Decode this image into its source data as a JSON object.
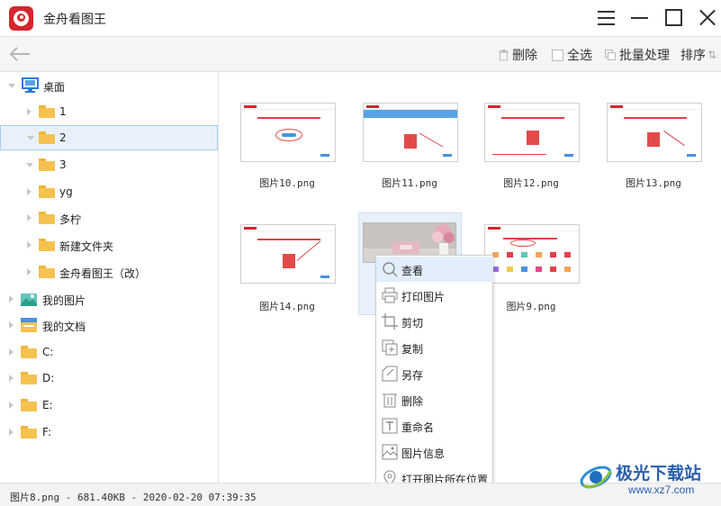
{
  "app": {
    "title": "金舟看图王"
  },
  "toolbar": {
    "delete_label": "删除",
    "select_all_label": "全选",
    "batch_label": "批量处理",
    "sort_label": "排序"
  },
  "sidebar": {
    "items": [
      {
        "label": "桌面",
        "icon": "desktop-icon"
      },
      {
        "label": "1",
        "icon": "folder-icon"
      },
      {
        "label": "2",
        "icon": "folder-icon"
      },
      {
        "label": "3",
        "icon": "folder-icon"
      },
      {
        "label": "yg",
        "icon": "folder-icon"
      },
      {
        "label": "多柠",
        "icon": "folder-icon"
      },
      {
        "label": "新建文件夹",
        "icon": "folder-icon"
      },
      {
        "label": "金舟看图王（改）",
        "icon": "folder-icon"
      },
      {
        "label": "我的图片",
        "icon": "pictures-icon"
      },
      {
        "label": "我的文档",
        "icon": "documents-icon"
      },
      {
        "label": "C:",
        "icon": "folder-icon"
      },
      {
        "label": "D:",
        "icon": "folder-icon"
      },
      {
        "label": "E:",
        "icon": "folder-icon"
      },
      {
        "label": "F:",
        "icon": "folder-icon"
      }
    ],
    "selected": "2"
  },
  "thumbnails": [
    {
      "name": "图片10.png"
    },
    {
      "name": "图片11.png"
    },
    {
      "name": "图片12.png"
    },
    {
      "name": "图片13.png"
    },
    {
      "name": "图片14.png"
    },
    {
      "name": "图片8.png"
    },
    {
      "name": "图片9.png"
    }
  ],
  "context_menu": {
    "items": [
      {
        "label": "查看",
        "icon": "magnifier-icon"
      },
      {
        "label": "打印图片",
        "icon": "printer-icon"
      },
      {
        "label": "剪切",
        "icon": "crop-icon"
      },
      {
        "label": "复制",
        "icon": "copy-icon"
      },
      {
        "label": "另存",
        "icon": "save-as-icon"
      },
      {
        "label": "删除",
        "icon": "trash-icon"
      },
      {
        "label": "重命名",
        "icon": "rename-icon"
      },
      {
        "label": "图片信息",
        "icon": "image-info-icon"
      },
      {
        "label": "打开图片所在位置",
        "icon": "location-icon"
      }
    ],
    "highlighted": "查看"
  },
  "status": {
    "text": "图片8.png - 681.40KB - 2020-02-20 07:39:35"
  },
  "watermark": {
    "name": "极光下载站",
    "url": "www.xz7.com"
  },
  "colors": {
    "brand_red": "#d6252d",
    "folder_yellow": "#f6c24f",
    "selection_blue": "#e8f1fb",
    "watermark_blue": "#2a5fae"
  }
}
